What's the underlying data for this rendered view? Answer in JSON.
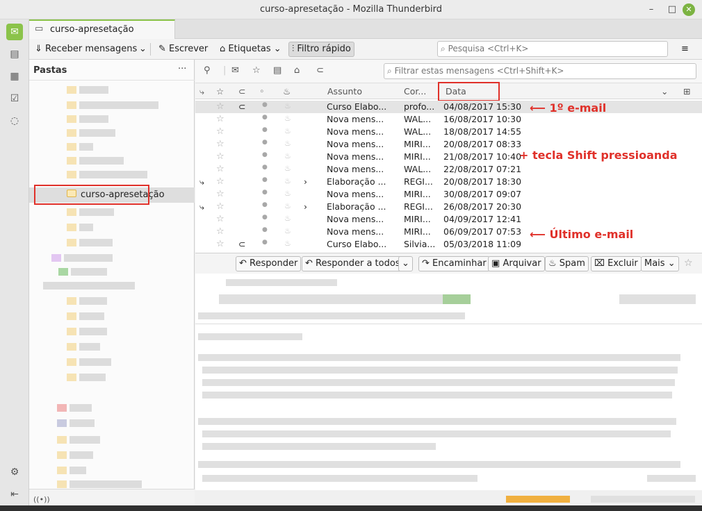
{
  "window": {
    "title": "curso-apresetação - Mozilla Thunderbird",
    "controls": {
      "minimize": "–",
      "maximize": "□",
      "close": "✕"
    }
  },
  "spaces": [
    "mail-icon",
    "address-book-icon",
    "calendar-icon",
    "tasks-icon",
    "chat-icon",
    "settings-icon",
    "collapse-icon"
  ],
  "tab": {
    "label": "curso-apresetação"
  },
  "toolbar": {
    "get_messages": "Receber mensagens",
    "write": "Escrever",
    "tags": "Etiquetas",
    "quick_filter": "Filtro rápido",
    "search_placeholder": "Pesquisa <Ctrl+K>",
    "menu_icon": "≡"
  },
  "folder_pane": {
    "header": "Pastas",
    "more": "···",
    "selected_folder": "curso-apresetação"
  },
  "quick_filter": {
    "filter_placeholder": "Filtrar estas mensagens <Ctrl+Shift+K>"
  },
  "columns": {
    "subject": "Assunto",
    "correspondent": "Cor...",
    "date": "Data"
  },
  "messages": [
    {
      "subject": "Curso Elabo...",
      "from": "profo...",
      "date": "04/08/2017 15:30",
      "attachment": true,
      "thread": false,
      "selected": true
    },
    {
      "subject": "Nova mens...",
      "from": "WAL...",
      "date": "16/08/2017 10:30",
      "attachment": false,
      "thread": false,
      "selected": false
    },
    {
      "subject": "Nova mens...",
      "from": "WAL...",
      "date": "18/08/2017 14:55",
      "attachment": false,
      "thread": false,
      "selected": false
    },
    {
      "subject": "Nova mens...",
      "from": "MIRI...",
      "date": "20/08/2017 08:33",
      "attachment": false,
      "thread": false,
      "selected": false
    },
    {
      "subject": "Nova mens...",
      "from": "MIRI...",
      "date": "21/08/2017 10:40",
      "attachment": false,
      "thread": false,
      "selected": false
    },
    {
      "subject": "Nova mens...",
      "from": "WAL...",
      "date": "22/08/2017 07:21",
      "attachment": false,
      "thread": false,
      "selected": false
    },
    {
      "subject": "Elaboração ...",
      "from": "REGI...",
      "date": "20/08/2017 18:30",
      "attachment": false,
      "thread": true,
      "selected": false
    },
    {
      "subject": "Nova mens...",
      "from": "MIRI...",
      "date": "30/08/2017 09:07",
      "attachment": false,
      "thread": false,
      "selected": false
    },
    {
      "subject": "Elaboração ...",
      "from": "REGI...",
      "date": "26/08/2017 20:30",
      "attachment": false,
      "thread": true,
      "selected": false
    },
    {
      "subject": "Nova mens...",
      "from": "MIRI...",
      "date": "04/09/2017 12:41",
      "attachment": false,
      "thread": false,
      "selected": false
    },
    {
      "subject": "Nova mens...",
      "from": "MIRI...",
      "date": "06/09/2017 07:53",
      "attachment": false,
      "thread": false,
      "selected": false
    },
    {
      "subject": "Curso Elabo...",
      "from": "Silvia...",
      "date": "05/03/2018 11:09",
      "attachment": true,
      "thread": false,
      "selected": false
    }
  ],
  "annotations": {
    "first": "1º e-mail",
    "shift": "+ tecla Shift pressioanda",
    "last": "Último e-mail"
  },
  "message_actions": {
    "reply": "Responder",
    "reply_all": "Responder a todos",
    "forward": "Encaminhar",
    "archive": "Arquivar",
    "spam": "Spam",
    "delete": "Excluir",
    "more": "Mais"
  },
  "colors": {
    "accent": "#8bc34a",
    "annotation_red": "#e0312a"
  }
}
